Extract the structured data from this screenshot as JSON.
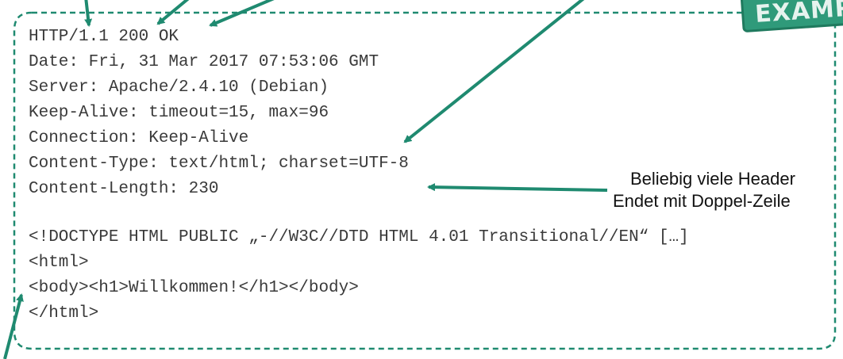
{
  "stamp": {
    "text": "EXAMPLE"
  },
  "response": {
    "headers": [
      "HTTP/1.1 200 OK",
      "Date: Fri, 31 Mar 2017 07:53:06 GMT",
      "Server: Apache/2.4.10 (Debian)",
      "Keep-Alive: timeout=15, max=96",
      "Connection: Keep-Alive",
      "Content-Type: text/html; charset=UTF-8",
      "Content-Length: 230"
    ],
    "body": [
      "<!DOCTYPE HTML PUBLIC „-//W3C//DTD HTML 4.01 Transitional//EN“ […]",
      "<html>",
      "<body><h1>Willkommen!</h1></body>",
      "</html>"
    ]
  },
  "annotation": {
    "line1": "Beliebig viele Header",
    "line2": "Endet mit Doppel-Zeile"
  },
  "colors": {
    "accent": "#1f8a70",
    "code_text": "#3a3a3a"
  }
}
